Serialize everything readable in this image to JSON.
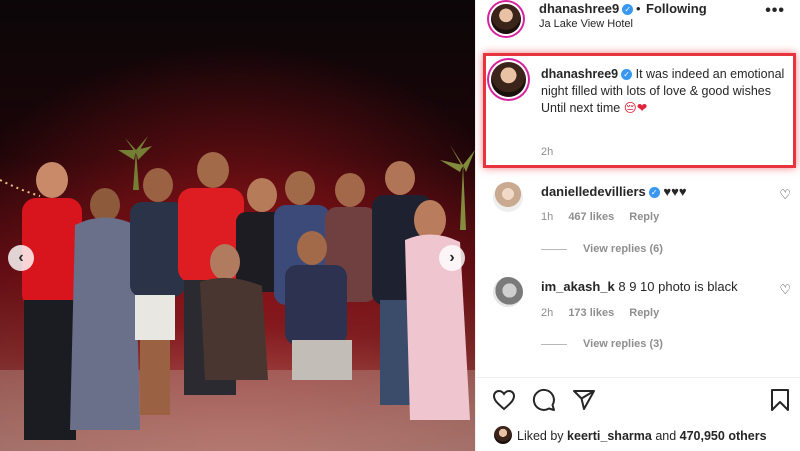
{
  "post": {
    "author": "dhanashree9",
    "follow_status": "Following",
    "location": "Ja Lake View Hotel",
    "more_icon": "ellipsis-icon"
  },
  "caption": {
    "username": "dhanashree9",
    "text_line1": "It was indeed an emotional night filled with lots of love & good wishes",
    "text_line2": "Until next time",
    "emoji": "😔❤",
    "time": "2h"
  },
  "comments": [
    {
      "username": "danielledevilliers",
      "text": "♥♥♥",
      "time": "1h",
      "likes": "467 likes",
      "reply_label": "Reply",
      "view_replies": "View replies (6)"
    },
    {
      "username": "im_akash_k",
      "text": "8 9 10 photo is black",
      "time": "2h",
      "likes": "173 likes",
      "reply_label": "Reply",
      "view_replies": "View replies (3)"
    }
  ],
  "likes_summary": {
    "prefix": "Liked by",
    "user": "keerti_sharma",
    "and": "and",
    "others": "470,950 others"
  },
  "icons": [
    "heart-icon",
    "comment-icon",
    "share-icon",
    "bookmark-icon",
    "verified-icon",
    "chevron-left-icon",
    "chevron-right-icon"
  ],
  "colors": {
    "highlight": "#e8343c",
    "verified": "#3897f0",
    "photo_glow": "#b3141e"
  }
}
